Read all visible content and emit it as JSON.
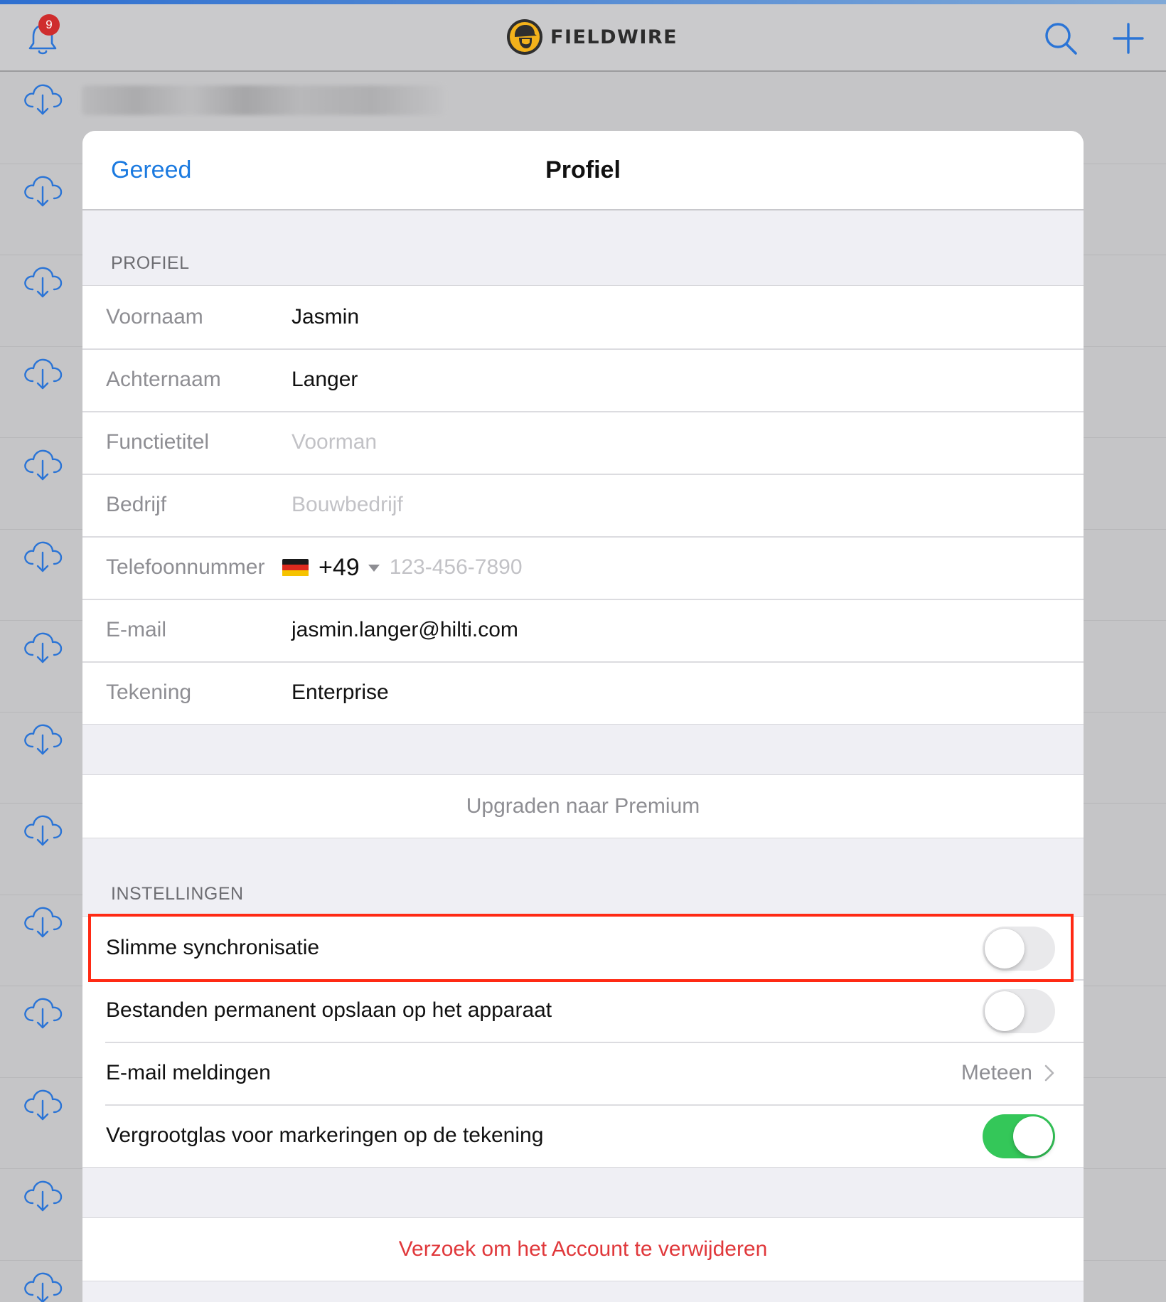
{
  "topbar": {
    "notification_count": "9",
    "brand_name": "FIELDWIRE",
    "icons": [
      "bell-icon",
      "search-icon",
      "plus-icon"
    ]
  },
  "background_list": {
    "row_icon": "cloud-download-icon",
    "row_count": 14
  },
  "modal": {
    "done_label": "Gereed",
    "title": "Profiel",
    "profile_section": {
      "header": "PROFIEL",
      "fields": [
        {
          "label": "Voornaam",
          "value": "Jasmin",
          "is_placeholder": false
        },
        {
          "label": "Achternaam",
          "value": "Langer",
          "is_placeholder": false
        },
        {
          "label": "Functietitel",
          "value": "Voorman",
          "is_placeholder": true
        },
        {
          "label": "Bedrijf",
          "value": "Bouwbedrijf",
          "is_placeholder": true
        }
      ],
      "phone": {
        "label": "Telefoonnummer",
        "country_code": "+49",
        "country": "Germany",
        "placeholder": "123-456-7890"
      },
      "email": {
        "label": "E-mail",
        "value": "jasmin.langer@hilti.com"
      },
      "plan": {
        "label": "Tekening",
        "value": "Enterprise"
      }
    },
    "upgrade_label": "Upgraden naar Premium",
    "settings_section": {
      "header": "INSTELLINGEN",
      "smart_sync": {
        "label": "Slimme synchronisatie",
        "enabled": false,
        "highlighted": true
      },
      "store_files": {
        "label": "Bestanden permanent opslaan op het apparaat",
        "enabled": false
      },
      "email_notifications": {
        "label": "E-mail meldingen",
        "value": "Meteen"
      },
      "magnifier": {
        "label": "Vergrootglas voor markeringen op de tekening",
        "enabled": true
      }
    },
    "delete_account_label": "Verzoek om het Account te verwijderen"
  },
  "colors": {
    "accent_blue": "#1b7ae0",
    "destructive_red": "#e0383b",
    "toggle_on_green": "#34c759",
    "highlight_red": "#ff2a14",
    "badge_red": "#cf2d2d"
  }
}
